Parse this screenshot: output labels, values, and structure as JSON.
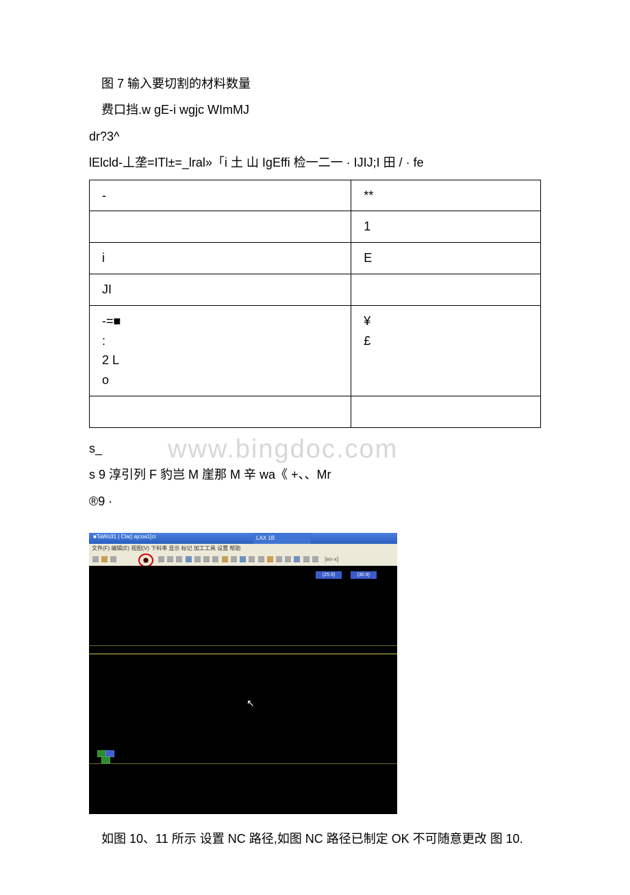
{
  "paragraphs": {
    "p1": "图 7 输入要切割的材料数量",
    "p2": "费口挡.w gE-i wgjc WImMJ",
    "p3": "dr?3^",
    "p4": "lElcld-丄垄=ITl±=_lral»「i 土 山 IgEffi 检一二一 · IJIJ;I 田 / · fe",
    "p5": "s_",
    "p6": "s 9 淳引列 F 豹岂 M 崖那 M 辛 wa《 +、、Mr",
    "p7": "®9 ·",
    "p8": "如图 10、11 所示 设置 NC 路径,如图 NC 路径已制定 OK 不可随意更改 图 10."
  },
  "table": {
    "rows": [
      {
        "c1": "-",
        "c2": "**"
      },
      {
        "c1": "",
        "c2": "1"
      },
      {
        "c1": "i",
        "c2": "E"
      },
      {
        "c1": "JI",
        "c2": ""
      }
    ],
    "merged": {
      "left": [
        "-=■",
        ":",
        "2 L",
        "o"
      ],
      "right": [
        "",
        "¥",
        "£",
        ""
      ]
    }
  },
  "watermark": "www.bingdoc.com",
  "screenshot": {
    "title_left": "■TaWo31 | Cla(| ajcoa1[cr",
    "title_center": "LAX 1B",
    "menubar": "文件(F)  编辑(E)  视图(V)  下料率  显示  标记  加工工具  设置  帮助",
    "toolbar_btn_label": "[en-x]",
    "tab1": "(25.9)",
    "tab2": "(30.9)"
  }
}
